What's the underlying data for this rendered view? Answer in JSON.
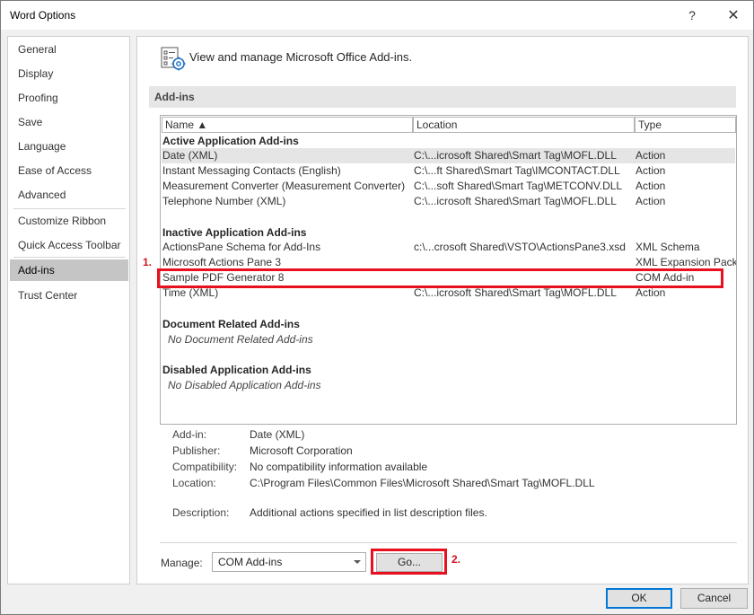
{
  "window": {
    "title": "Word Options",
    "help_glyph": "?",
    "close_glyph": "✕"
  },
  "sidebar": {
    "items": [
      {
        "label": "General"
      },
      {
        "label": "Display"
      },
      {
        "label": "Proofing"
      },
      {
        "label": "Save"
      },
      {
        "label": "Language"
      },
      {
        "label": "Ease of Access"
      },
      {
        "label": "Advanced"
      },
      {
        "label": "Customize Ribbon"
      },
      {
        "label": "Quick Access Toolbar"
      },
      {
        "label": "Add-ins"
      },
      {
        "label": "Trust Center"
      }
    ],
    "selected": "Add-ins"
  },
  "main": {
    "header_icon": "addins-gear-icon",
    "header_text": "View and manage Microsoft Office Add-ins.",
    "section_title": "Add-ins"
  },
  "list": {
    "columns": [
      {
        "label": "Name ▲"
      },
      {
        "label": "Location"
      },
      {
        "label": "Type"
      }
    ],
    "groups": {
      "active": {
        "title": "Active Application Add-ins",
        "rows": [
          {
            "name": "Date (XML)",
            "location": "C:\\...icrosoft Shared\\Smart Tag\\MOFL.DLL",
            "type": "Action"
          },
          {
            "name": "Instant Messaging Contacts (English)",
            "location": "C:\\...ft Shared\\Smart Tag\\IMCONTACT.DLL",
            "type": "Action"
          },
          {
            "name": "Measurement Converter (Measurement Converter)",
            "location": "C:\\...soft Shared\\Smart Tag\\METCONV.DLL",
            "type": "Action"
          },
          {
            "name": "Telephone Number (XML)",
            "location": "C:\\...icrosoft Shared\\Smart Tag\\MOFL.DLL",
            "type": "Action"
          }
        ]
      },
      "inactive": {
        "title": "Inactive Application Add-ins",
        "rows": [
          {
            "name": "ActionsPane Schema for Add-Ins",
            "location": "c:\\...crosoft Shared\\VSTO\\ActionsPane3.xsd",
            "type": "XML Schema"
          },
          {
            "name": "Microsoft Actions Pane 3",
            "location": "",
            "type": "XML Expansion Pack"
          },
          {
            "name": "Sample PDF Generator 8",
            "location": "",
            "type": "COM Add-in"
          },
          {
            "name": "Time (XML)",
            "location": "C:\\...icrosoft Shared\\Smart Tag\\MOFL.DLL",
            "type": "Action"
          }
        ]
      },
      "document": {
        "title": "Document Related Add-ins",
        "empty": "No Document Related Add-ins"
      },
      "disabled": {
        "title": "Disabled Application Add-ins",
        "empty": "No Disabled Application Add-ins"
      }
    }
  },
  "details": {
    "addin_label": "Add-in:",
    "addin": "Date (XML)",
    "publisher_label": "Publisher:",
    "publisher": "Microsoft Corporation",
    "compat_label": "Compatibility:",
    "compat": "No compatibility information available",
    "location_label": "Location:",
    "location": "C:\\Program Files\\Common Files\\Microsoft Shared\\Smart Tag\\MOFL.DLL",
    "desc_label": "Description:",
    "desc": "Additional actions specified in list description files."
  },
  "manage": {
    "label": "Manage:",
    "selected": "COM Add-ins",
    "go_label": "Go..."
  },
  "footer": {
    "ok_label": "OK",
    "cancel_label": "Cancel"
  },
  "annotations": {
    "one": "1.",
    "two": "2.",
    "color": "#e8101e"
  }
}
